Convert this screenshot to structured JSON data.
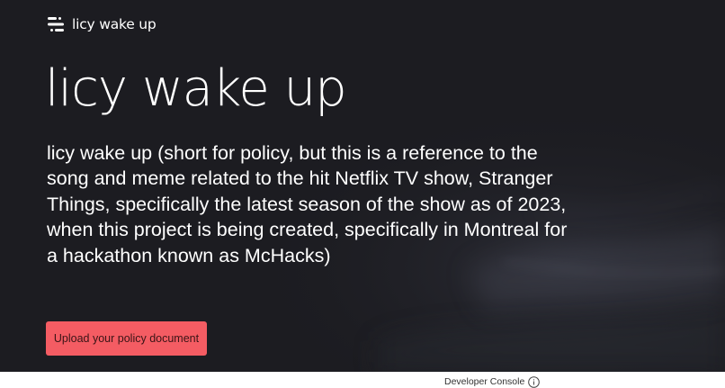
{
  "nav": {
    "brand": "licy wake up",
    "logo_icon": "logo-lines-icon"
  },
  "hero": {
    "title": "licy wake up",
    "description": "licy wake up (short for policy, but this is a reference to the song and meme related to the hit Netflix TV show, Stranger Things, specifically the latest season of the show as of 2023, when this project is being created, specifically in Montreal for a hackathon known as McHacks)",
    "upload_button": "Upload your policy document"
  },
  "footer": {
    "developer_console": "Developer Console",
    "info_icon": "info-icon"
  },
  "colors": {
    "hero_background": "#1c1c21",
    "button_accent": "#f45c63",
    "text": "#ffffff"
  }
}
